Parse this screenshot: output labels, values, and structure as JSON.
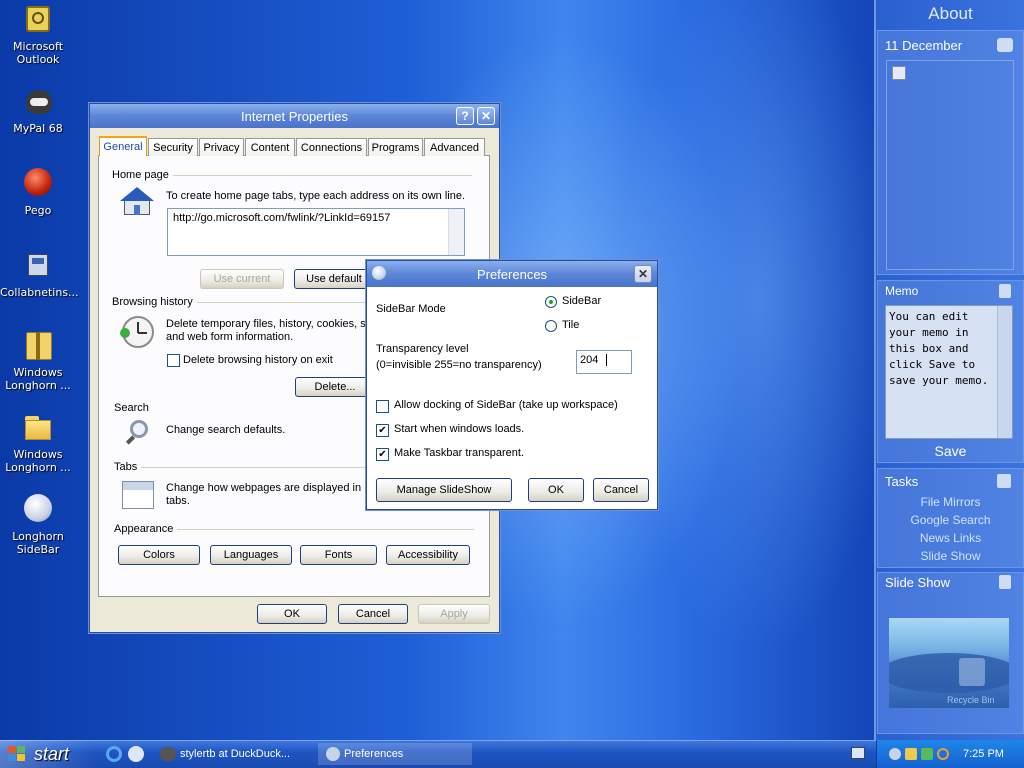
{
  "desktop_icons": [
    {
      "label": "Microsoft Outlook",
      "icon": "outlook-icon"
    },
    {
      "label": "MyPal 68",
      "icon": "mypal-icon"
    },
    {
      "label": "Pego",
      "icon": "pego-icon"
    },
    {
      "label": "Collabnetins...",
      "icon": "collabnet-icon"
    },
    {
      "label": "Windows Longhorn ...",
      "icon": "installer-icon"
    },
    {
      "label": "Windows Longhorn ...",
      "icon": "folder-icon"
    },
    {
      "label": "Longhorn SideBar",
      "icon": "sidebar-app-icon"
    }
  ],
  "inet": {
    "title": "Internet Properties",
    "help": "?",
    "close": "✕",
    "tabs": [
      "General",
      "Security",
      "Privacy",
      "Content",
      "Connections",
      "Programs",
      "Advanced"
    ],
    "active_tab": "General",
    "home_page_group": "Home page",
    "home_page_desc": "To create home page tabs, type each address on its own line.",
    "home_page_url": "http://go.microsoft.com/fwlink/?LinkId=69157",
    "use_current": "Use current",
    "use_default": "Use default",
    "browsing_group": "Browsing history",
    "browsing_desc": "Delete temporary files, history, cookies, s",
    "browsing_desc2": "and web form information.",
    "delete_on_exit": "Delete browsing history on exit",
    "delete_btn": "Delete...",
    "search_group": "Search",
    "search_desc": "Change search defaults.",
    "tabs_group": "Tabs",
    "tabs_desc": "Change how webpages are displayed in",
    "tabs_desc2": "tabs.",
    "appearance_group": "Appearance",
    "colors": "Colors",
    "languages": "Languages",
    "fonts": "Fonts",
    "accessibility": "Accessibility",
    "ok": "OK",
    "cancel": "Cancel",
    "apply": "Apply"
  },
  "prefs": {
    "title": "Preferences",
    "close": "✕",
    "mode_label": "SideBar Mode",
    "opt_sidebar": "SideBar",
    "opt_tile": "Tile",
    "selected_mode": "SideBar",
    "transparency_label": "Transparency level",
    "transparency_hint": "(0=invisible 255=no transparency)",
    "transparency_value": "204",
    "allow_docking": "Allow docking of SideBar (take up workspace)",
    "allow_docking_checked": false,
    "start_windows": "Start when windows loads.",
    "start_windows_checked": true,
    "taskbar_transparent": "Make Taskbar transparent.",
    "taskbar_transparent_checked": true,
    "manage": "Manage SlideShow",
    "ok": "OK",
    "cancel": "Cancel"
  },
  "sidebar": {
    "about": "About",
    "date": "11 December",
    "memo_title": "Memo",
    "memo_text": "You can edit your memo in this box and click Save to save your memo.",
    "save": "Save",
    "tasks_title": "Tasks",
    "tasks": [
      "File Mirrors",
      "Google Search",
      "News Links",
      "Slide Show"
    ],
    "slideshow_title": "Slide Show",
    "slideshow_caption": "Recycle Bin"
  },
  "taskbar": {
    "start": "start",
    "items": [
      "stylertb at DuckDuck...",
      "Preferences"
    ],
    "clock": "7:25 PM"
  }
}
